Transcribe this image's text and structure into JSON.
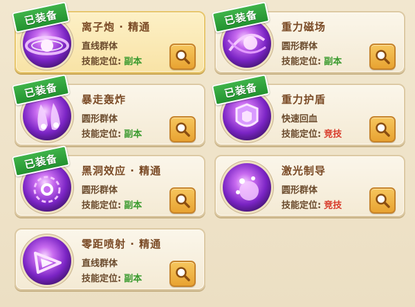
{
  "labels": {
    "equipped_badge": "已装备",
    "position_prefix": "技能定位:"
  },
  "skills": [
    {
      "name": "离子炮 · 精通",
      "type": "直线群体",
      "position": "副本",
      "equipped": true,
      "selected": true,
      "role": "pve",
      "icon": "ion-cannon-icon"
    },
    {
      "name": "重力磁场",
      "type": "圆形群体",
      "position": "副本",
      "equipped": true,
      "selected": false,
      "role": "pve",
      "icon": "gravity-field-icon"
    },
    {
      "name": "暴走轰炸",
      "type": "圆形群体",
      "position": "副本",
      "equipped": true,
      "selected": false,
      "role": "pve",
      "icon": "rampage-bombing-icon"
    },
    {
      "name": "重力护盾",
      "type": "快速回血",
      "position": "竞技",
      "equipped": true,
      "selected": false,
      "role": "pvp",
      "icon": "gravity-shield-icon"
    },
    {
      "name": "黑洞效应 · 精通",
      "type": "圆形群体",
      "position": "副本",
      "equipped": true,
      "selected": false,
      "role": "pve",
      "icon": "black-hole-icon"
    },
    {
      "name": "激光制导",
      "type": "圆形群体",
      "position": "竞技",
      "equipped": false,
      "selected": false,
      "role": "pvp",
      "icon": "laser-guidance-icon"
    },
    {
      "name": "零距喷射 · 精通",
      "type": "直线群体",
      "position": "副本",
      "equipped": false,
      "selected": false,
      "role": "pve",
      "icon": "zero-range-jet-icon"
    }
  ],
  "colors": {
    "pve": "#3a9a2e",
    "pvp": "#d83a2a",
    "badge": "#2fa23b",
    "selected_card": "#fbe8b0"
  }
}
